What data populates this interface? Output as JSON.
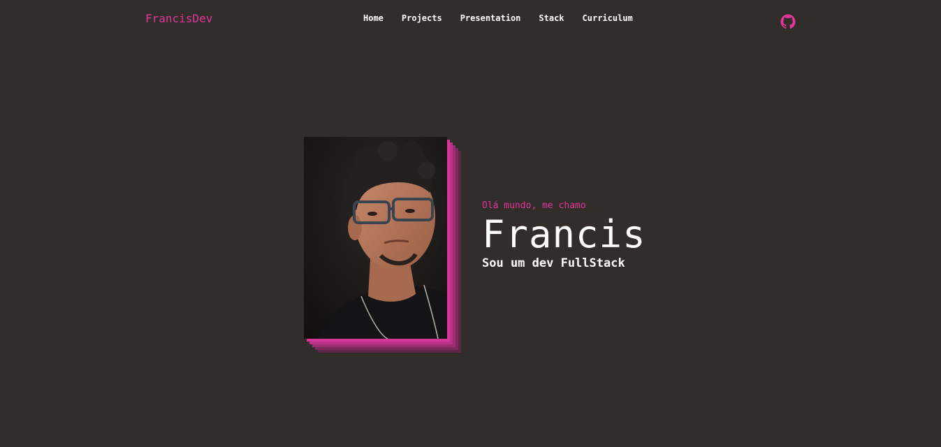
{
  "header": {
    "logo": "FrancisDev",
    "nav": [
      {
        "label": "Home"
      },
      {
        "label": "Projects"
      },
      {
        "label": "Presentation"
      },
      {
        "label": "Stack"
      },
      {
        "label": "Curriculum"
      }
    ],
    "github_icon": "github-icon"
  },
  "hero": {
    "greeting": "Olá mundo, me chamo",
    "name": "Francis",
    "role": "Sou um dev FullStack",
    "photo": "profile-photo"
  },
  "colors": {
    "background": "#312d2b",
    "accent": "#e0359b",
    "text": "#ffffff"
  }
}
